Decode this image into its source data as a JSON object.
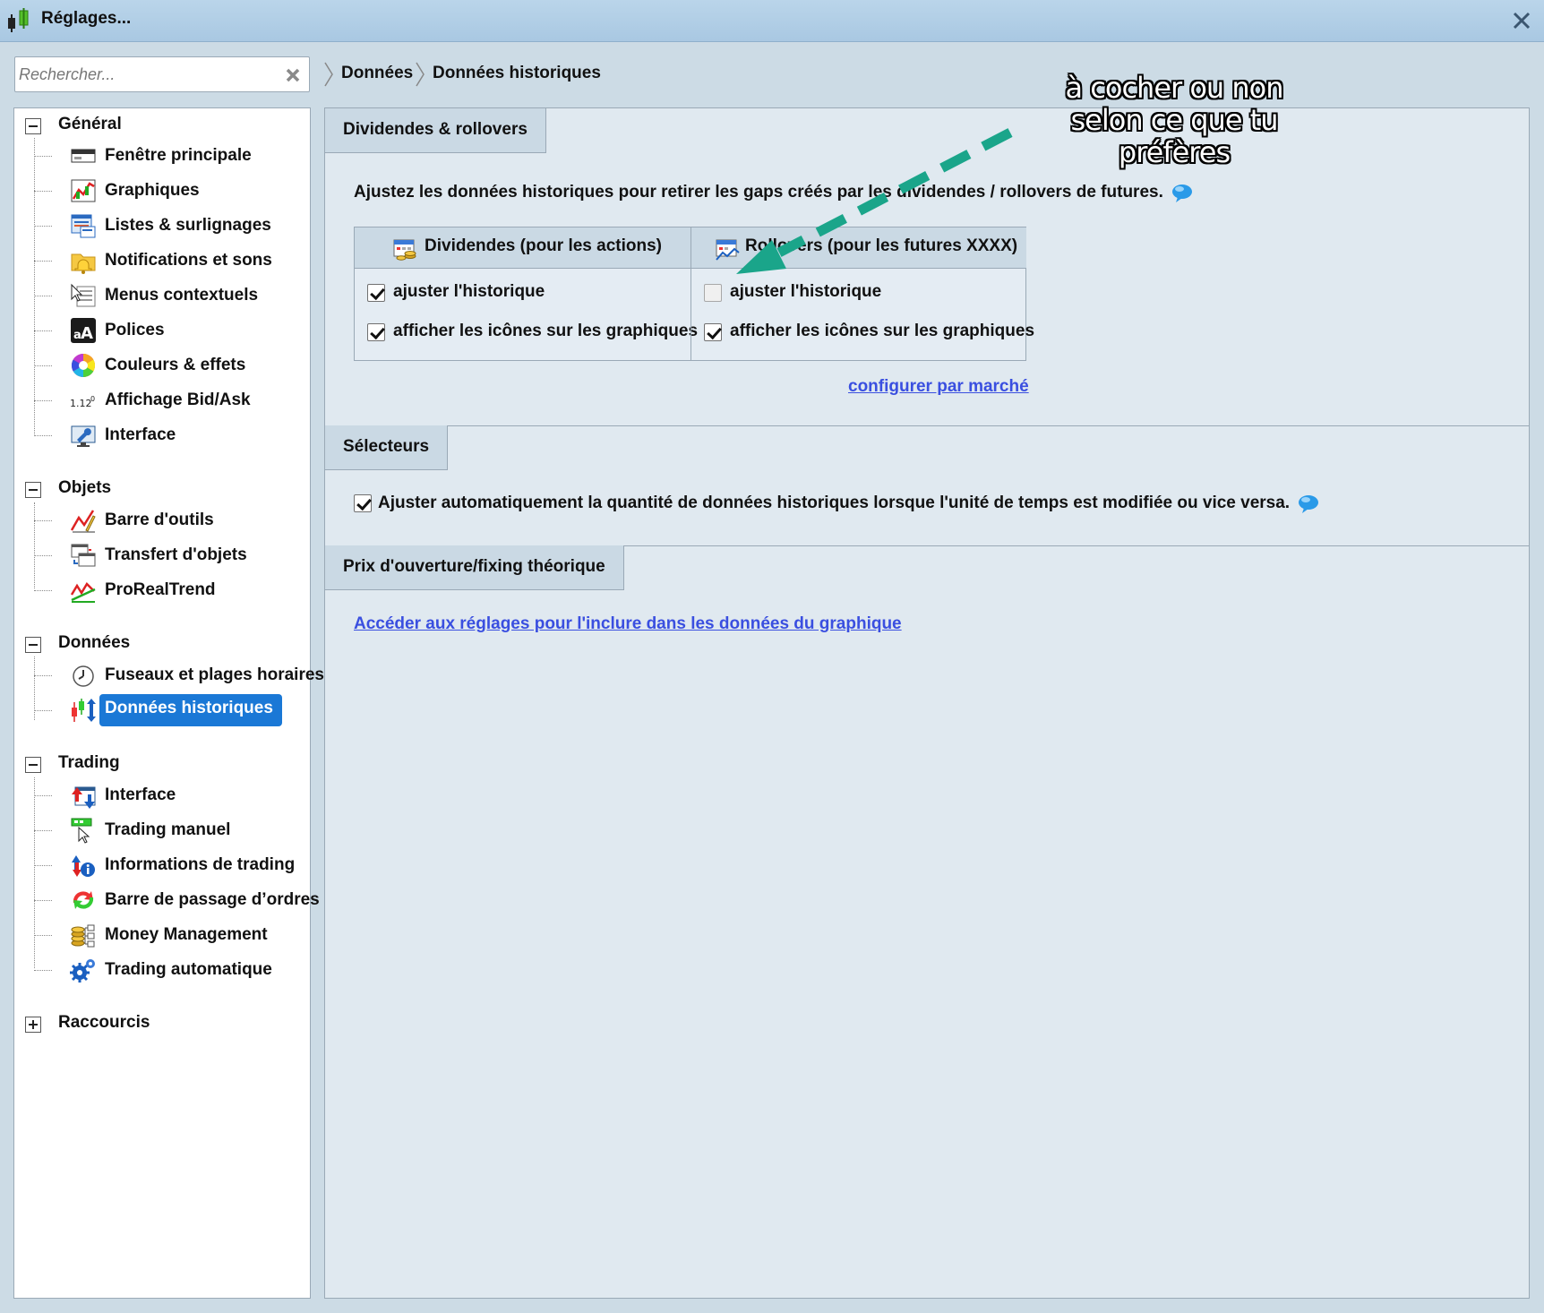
{
  "window": {
    "title": "Réglages..."
  },
  "search": {
    "placeholder": "Rechercher..."
  },
  "sidebar": {
    "groups": [
      {
        "label": "Général",
        "items": [
          {
            "label": "Fenêtre principale",
            "icon": "window-icon"
          },
          {
            "label": "Graphiques",
            "icon": "charts-icon"
          },
          {
            "label": "Listes & surlignages",
            "icon": "lists-icon"
          },
          {
            "label": "Notifications et sons",
            "icon": "bell-folder-icon"
          },
          {
            "label": "Menus contextuels",
            "icon": "context-menu-icon"
          },
          {
            "label": "Polices",
            "icon": "fonts-icon"
          },
          {
            "label": "Couleurs & effets",
            "icon": "color-wheel-icon"
          },
          {
            "label": "Affichage Bid/Ask",
            "icon": "bid-ask-icon"
          },
          {
            "label": "Interface",
            "icon": "interface-wrench-icon"
          }
        ]
      },
      {
        "label": "Objets",
        "items": [
          {
            "label": "Barre d'outils",
            "icon": "drawing-tools-icon"
          },
          {
            "label": "Transfert d'objets",
            "icon": "transfer-objects-icon"
          },
          {
            "label": "ProRealTrend",
            "icon": "trend-icon"
          }
        ]
      },
      {
        "label": "Données",
        "items": [
          {
            "label": "Fuseaux et plages horaires",
            "icon": "clock-icon"
          },
          {
            "label": "Données historiques",
            "icon": "historical-data-icon",
            "selected": true
          }
        ]
      },
      {
        "label": "Trading",
        "items": [
          {
            "label": "Interface",
            "icon": "trading-interface-icon"
          },
          {
            "label": "Trading manuel",
            "icon": "manual-trading-icon"
          },
          {
            "label": "Informations de trading",
            "icon": "trading-info-icon"
          },
          {
            "label": "Barre de passage d’ordres",
            "icon": "order-bar-icon"
          },
          {
            "label": "Money Management",
            "icon": "money-management-icon"
          },
          {
            "label": "Trading automatique",
            "icon": "gears-icon"
          }
        ]
      },
      {
        "label": "Raccourcis",
        "items": [],
        "collapsed": true
      }
    ]
  },
  "breadcrumb": [
    "Données",
    "Données historiques"
  ],
  "sections": {
    "dividends": {
      "tab": "Dividendes & rollovers",
      "description": "Ajustez les données historiques pour retirer les gaps créés par les dividendes / rollovers de futures.",
      "dividends_col": {
        "header": "Dividendes (pour les actions)",
        "adjust": {
          "label": "ajuster l'historique",
          "checked": true
        },
        "icons": {
          "label": "afficher les icônes sur les graphiques",
          "checked": true
        }
      },
      "rollovers_col": {
        "header": "Rollovers (pour les futures XXXX)",
        "adjust": {
          "label": "ajuster l'historique",
          "checked": false
        },
        "icons": {
          "label": "afficher les icônes sur les graphiques",
          "checked": true
        }
      },
      "link": "configurer par marché"
    },
    "selectors": {
      "tab": "Sélecteurs",
      "option": {
        "label": "Ajuster automatiquement la quantité de données historiques lorsque l'unité de temps est modifiée ou vice versa.",
        "checked": true
      }
    },
    "opening": {
      "tab": "Prix d'ouverture/fixing théorique",
      "link": "Accéder aux réglages pour l'inclure dans les données du graphique"
    }
  },
  "annotation": {
    "lines": [
      "à cocher ou non",
      "selon ce que tu",
      "préfères"
    ],
    "arrow_color": "#1aa58a"
  },
  "colors": {
    "accent": "#1a78d6",
    "link": "#3a4fe0",
    "panel": "#e0e9f0",
    "tab": "#cad9e4"
  }
}
